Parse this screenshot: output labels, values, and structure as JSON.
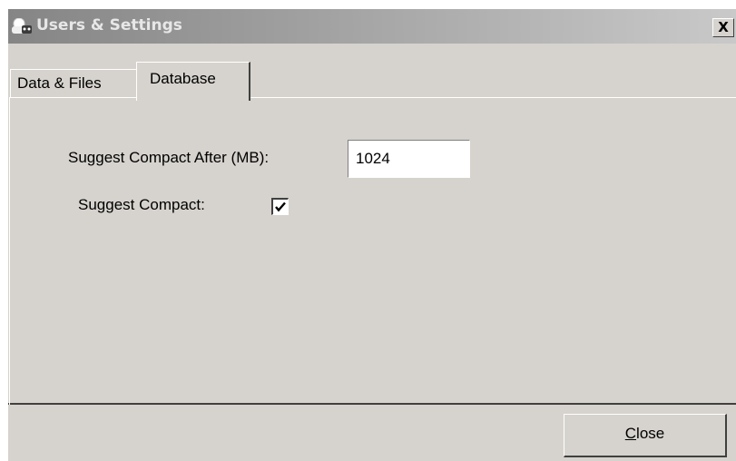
{
  "window": {
    "title": "Users & Settings",
    "close_glyph": "X"
  },
  "tabs": [
    {
      "label": "Data & Files",
      "selected": false
    },
    {
      "label": "Database",
      "selected": true
    }
  ],
  "database": {
    "compact_after_label": "Suggest Compact After (MB):",
    "compact_after_value": "1024",
    "suggest_compact_label": "Suggest Compact:",
    "suggest_compact_checked": true
  },
  "footer": {
    "close_accel": "C",
    "close_rest": "lose"
  },
  "icons": {
    "app": "app-icon",
    "close": "close-icon",
    "checkmark": "checkmark-icon"
  },
  "colors": {
    "window_bg": "#d6d3ce",
    "title_text": "#e7e7e7"
  }
}
